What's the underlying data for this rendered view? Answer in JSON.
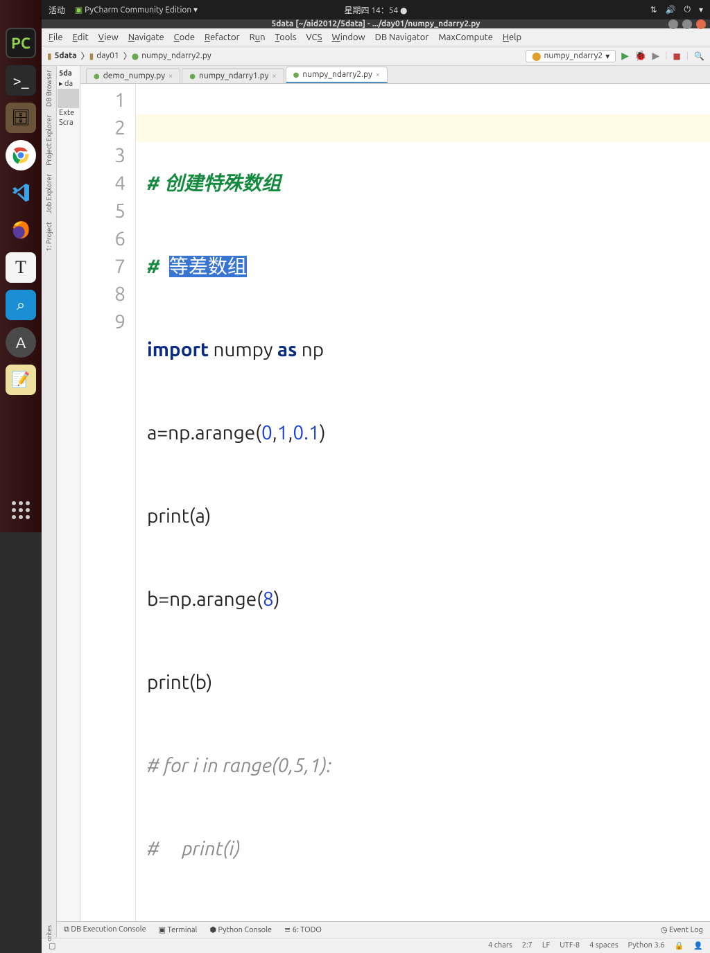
{
  "top_panel": {
    "activities": "活动",
    "app_name": "PyCharm Community Edition ▾",
    "clock": "星期四 14：54 ●"
  },
  "titlebar": {
    "title": "5data [~/aid2012/5data] - .../day01/numpy_ndarry2.py"
  },
  "menu": {
    "file": "File",
    "edit": "Edit",
    "view": "View",
    "navigate": "Navigate",
    "code": "Code",
    "refactor": "Refactor",
    "run": "Run",
    "tools": "Tools",
    "vcs": "VCS",
    "window": "Window",
    "db": "DB Navigator",
    "maxcompute": "MaxCompute",
    "help": "Help"
  },
  "breadcrumbs": {
    "root": "5data",
    "folder": "day01",
    "file": "numpy_ndarry2.py"
  },
  "run_config": {
    "name": "numpy_ndarry2"
  },
  "project": {
    "root": "5da",
    "folder": "da",
    "ext": "Exte",
    "scratch": "Scra"
  },
  "left_tools": {
    "db": "DB Browser",
    "explorer": "Project Explorer",
    "job": "Job Explorer",
    "p1": "1: Project"
  },
  "fav_label": "orites",
  "tabs": {
    "t1": "demo_numpy.py",
    "t2": "numpy_ndarry1.py",
    "t3": "numpy_ndarry2.py"
  },
  "code": {
    "lines": [
      "1",
      "2",
      "3",
      "4",
      "5",
      "6",
      "7",
      "8",
      "9"
    ],
    "l1": {
      "hash": "# ",
      "text": "创建特殊数组"
    },
    "l2": {
      "hash": "#  ",
      "text": "等差数组"
    },
    "l3": {
      "kw1": "import",
      "mid": " numpy ",
      "kw2": "as",
      "end": " np"
    },
    "l4": {
      "pre": "a=np.arange(",
      "n1": "0",
      "c1": ",",
      "n2": "1",
      "c2": ",",
      "n3": "0.1",
      "post": ")"
    },
    "l5": "print(a)",
    "l6": {
      "pre": "b=np.arange(",
      "n1": "8",
      "post": ")"
    },
    "l7": "print(b)",
    "l8": "# for i in range(0,5,1):",
    "l9": "#     print(i)"
  },
  "bottom": {
    "db": "DB Execution Console",
    "terminal": "Terminal",
    "pyconsole": "Python Console",
    "todo": "6: TODO",
    "eventlog": "Event Log"
  },
  "status": {
    "chars": "4 chars",
    "pos": "2:7",
    "lf": "LF",
    "enc": "UTF-8",
    "indent": "4 spaces",
    "python": "Python 3.6"
  }
}
